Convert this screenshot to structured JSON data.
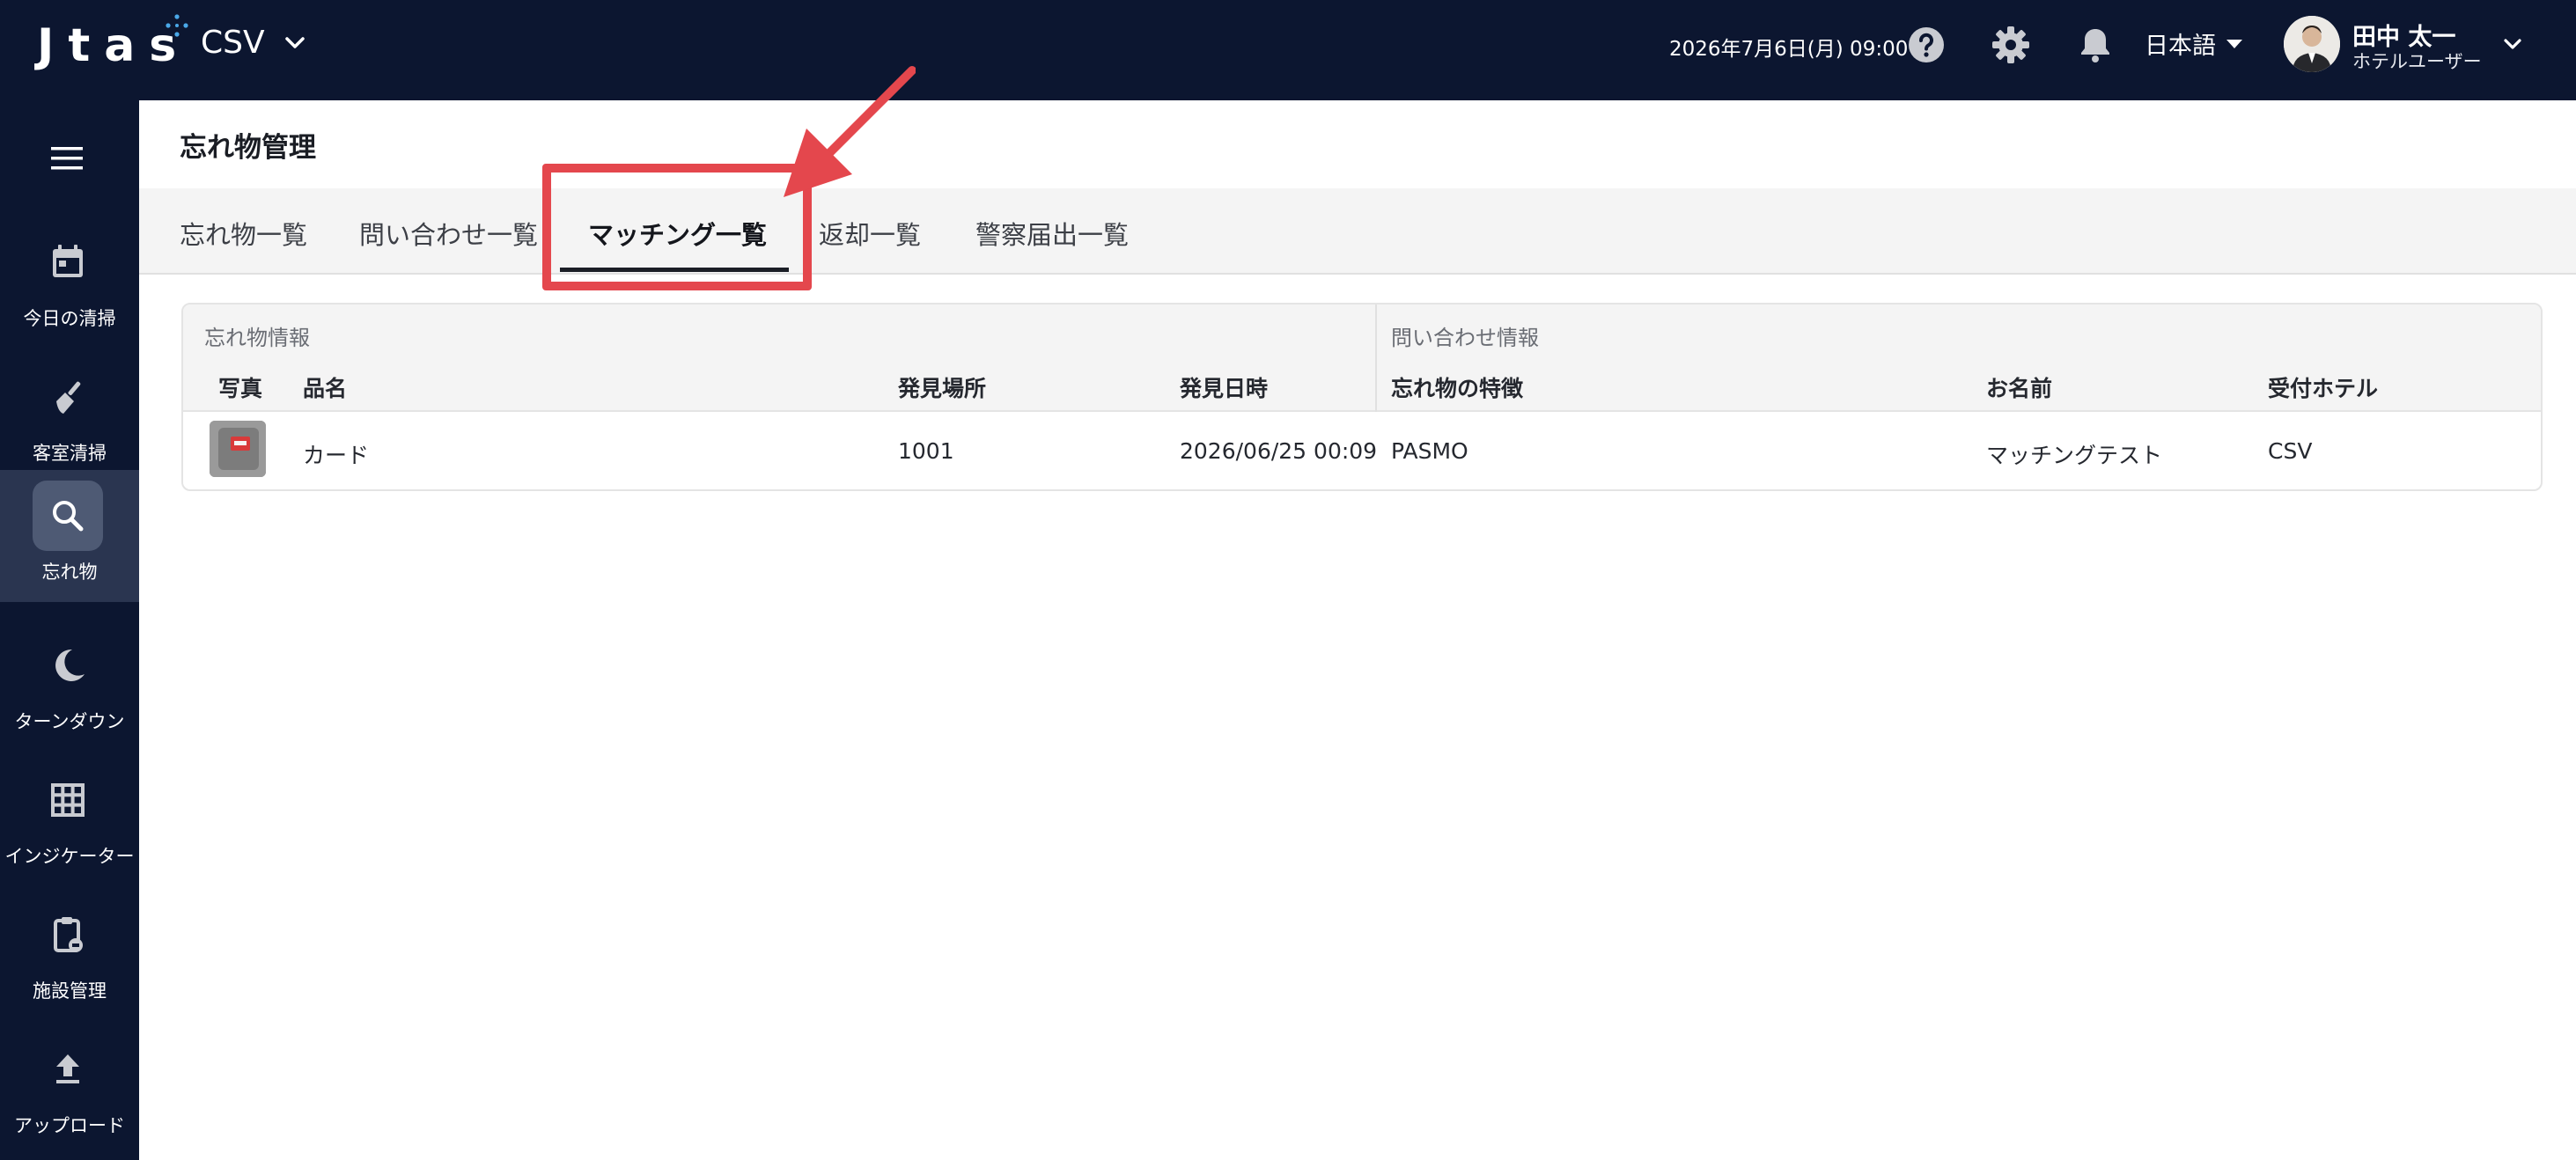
{
  "header": {
    "logo_text": "Jtas",
    "hotel": "CSV",
    "datetime": "2026年7月6日(月) 09:00",
    "language": "日本語",
    "user_name": "田中 太一",
    "user_role": "ホテルユーザー",
    "icons": [
      "help-icon",
      "gear-icon",
      "bell-icon"
    ]
  },
  "sidebar": {
    "items": [
      {
        "label": "今日の清掃",
        "icon": "calendar-icon",
        "active": false
      },
      {
        "label": "客室清掃",
        "icon": "broom-icon",
        "active": false
      },
      {
        "label": "忘れ物",
        "icon": "search-icon",
        "active": true
      },
      {
        "label": "ターンダウン",
        "icon": "moon-icon",
        "active": false
      },
      {
        "label": "インジケーター",
        "icon": "grid-icon",
        "active": false
      },
      {
        "label": "施設管理",
        "icon": "clipboard-icon",
        "active": false
      },
      {
        "label": "アップロード",
        "icon": "upload-icon",
        "active": false
      }
    ]
  },
  "page": {
    "title": "忘れ物管理",
    "tabs": [
      {
        "label": "忘れ物一覧",
        "active": false
      },
      {
        "label": "問い合わせ一覧",
        "active": false
      },
      {
        "label": "マッチング一覧",
        "active": true
      },
      {
        "label": "返却一覧",
        "active": false
      },
      {
        "label": "警察届出一覧",
        "active": false
      }
    ]
  },
  "table": {
    "group_lost_item": "忘れ物情報",
    "group_inquiry": "問い合わせ情報",
    "columns": [
      "写真",
      "品名",
      "発見場所",
      "発見日時",
      "忘れ物の特徴",
      "お名前",
      "受付ホテル"
    ],
    "rows": [
      {
        "item_name": "カード",
        "location": "1001",
        "found_at": "2026/06/25 00:09",
        "features": "PASMO",
        "name": "マッチングテスト",
        "hotel": "CSV"
      }
    ]
  },
  "colors": {
    "header_bg": "#0c1630",
    "highlight": "#e4474d",
    "tab_bg": "#f4f4f4"
  }
}
